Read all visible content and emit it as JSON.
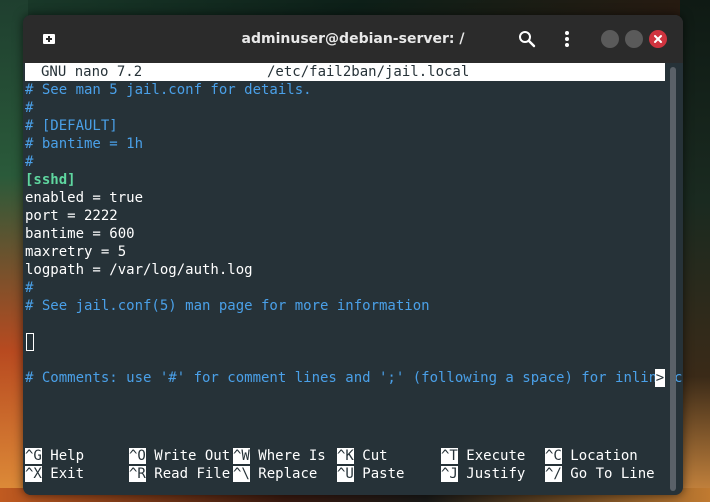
{
  "window": {
    "title": "adminuser@debian-server: /"
  },
  "nano": {
    "version_label": "GNU nano 7.2",
    "file_path": "/etc/fail2ban/jail.local"
  },
  "editor_lines": [
    {
      "text": "# See man 5 jail.conf for details.",
      "kind": "cmt"
    },
    {
      "text": "#",
      "kind": "cmt"
    },
    {
      "text": "# [DEFAULT]",
      "kind": "cmt"
    },
    {
      "text": "# bantime = 1h",
      "kind": "cmt"
    },
    {
      "text": "#",
      "kind": "cmt"
    },
    {
      "text": "[sshd]",
      "kind": "sec"
    },
    {
      "text": "enabled = true",
      "kind": "txt"
    },
    {
      "text": "port = 2222",
      "kind": "txt"
    },
    {
      "text": "bantime = 600",
      "kind": "txt"
    },
    {
      "text": "maxretry = 5",
      "kind": "txt"
    },
    {
      "text": "logpath = /var/log/auth.log",
      "kind": "txt"
    },
    {
      "text": "#",
      "kind": "cmt"
    },
    {
      "text": "# See jail.conf(5) man page for more information",
      "kind": "cmt"
    },
    {
      "text": "",
      "kind": "txt"
    },
    {
      "text": "",
      "kind": "cursor"
    },
    {
      "text": "",
      "kind": "txt"
    },
    {
      "text": "# Comments: use '#' for comment lines and ';' (following a space) for inline co",
      "kind": "cmt"
    }
  ],
  "overflow_marker": ">",
  "shortcuts": {
    "row1": [
      {
        "key": "^G",
        "label": "Help"
      },
      {
        "key": "^O",
        "label": "Write Out"
      },
      {
        "key": "^W",
        "label": "Where Is"
      },
      {
        "key": "^K",
        "label": "Cut"
      },
      {
        "key": "^T",
        "label": "Execute"
      },
      {
        "key": "^C",
        "label": "Location"
      }
    ],
    "row2": [
      {
        "key": "^X",
        "label": "Exit"
      },
      {
        "key": "^R",
        "label": "Read File"
      },
      {
        "key": "^\\",
        "label": "Replace"
      },
      {
        "key": "^U",
        "label": "Paste"
      },
      {
        "key": "^J",
        "label": "Justify"
      },
      {
        "key": "^/",
        "label": "Go To Line"
      }
    ]
  },
  "icons": {
    "new_tab": "new-tab-icon",
    "search": "search-icon",
    "menu": "kebab-menu-icon",
    "minimize": "minimize-icon",
    "maximize": "maximize-icon",
    "close": "close-icon"
  },
  "colors": {
    "terminal_bg": "#263238",
    "comment": "#4aa0e8",
    "section": "#5fd7a0",
    "close_button": "#d0343f"
  }
}
